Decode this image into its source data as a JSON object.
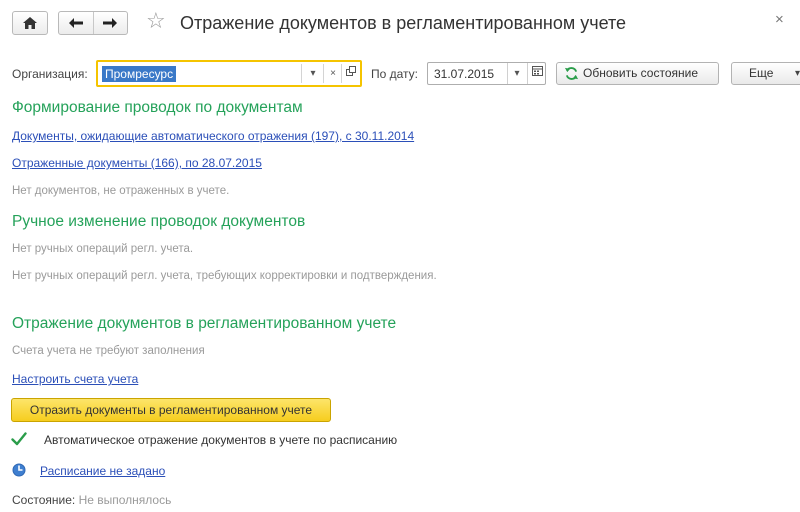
{
  "window": {
    "title": "Отражение документов в регламентированном учете",
    "close_glyph": "×"
  },
  "icons": {
    "home": "home-icon",
    "back": "arrow-left-icon",
    "forward": "arrow-right-icon",
    "favorite": "star-icon",
    "close": "close-icon",
    "refresh": "refresh-icon",
    "calendar": "calendar-icon",
    "checkbox": "checkmark-icon",
    "schedule": "clock-icon"
  },
  "toolbar": {
    "org_label": "Организация:",
    "org_value": "Промресурс",
    "date_label": "По дату:",
    "date_value": "31.07.2015",
    "refresh_label": "Обновить состояние",
    "more_label": "Еще"
  },
  "section1": {
    "heading": "Формирование проводок по документам",
    "link_pending": "Документы, ожидающие автоматического отражения (197), с 30.11.2014",
    "link_reflected": "Отраженные документы (166), по 28.07.2015",
    "note_not_reflected": "Нет документов, не отраженных в учете."
  },
  "section2": {
    "heading": "Ручное изменение проводок документов",
    "note_manual": "Нет ручных операций регл. учета.",
    "note_manual_correction": "Нет ручных операций регл. учета, требующих корректировки и подтверждения."
  },
  "section3": {
    "heading": "Отражение документов в регламентированном учете",
    "note_accounts": "Счета учета не требуют заполнения",
    "link_setup": "Настроить счета учета",
    "reflect_button": "Отразить документы в регламентированном учете",
    "auto_checkbox_label": "Автоматическое отражение документов в учете по расписанию",
    "auto_checkbox_checked": true,
    "schedule_link": "Расписание не задано",
    "status_label": "Состояние:",
    "status_value": "Не выполнялось"
  },
  "colors": {
    "accent_green": "#25a25a",
    "link_blue": "#2b4fb8",
    "selection_blue": "#3a79c8",
    "focus_yellow": "#f5c400",
    "button_yellow": "#f6cd1e"
  }
}
